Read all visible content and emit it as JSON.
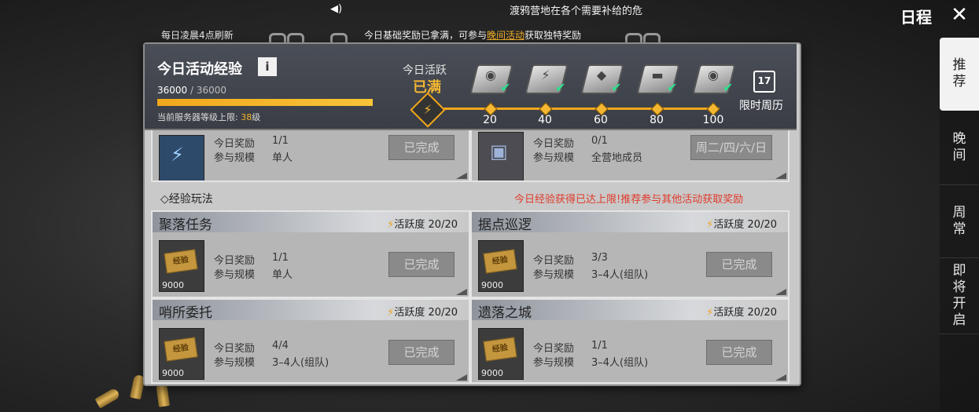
{
  "top": {
    "marquee": "渡鸦营地在各个需要补给的危",
    "schedule_title": "日程",
    "close_icon": "close-x-icon",
    "refresh_note": "每日凌晨4点刷新",
    "exp_note_prefix": "今日基础奖励已拿满，可参与",
    "exp_note_link": "晚间活动",
    "exp_note_suffix": "获取独特奖励"
  },
  "sidebar": {
    "tabs": [
      {
        "label": "推荐",
        "active": true
      },
      {
        "label": "晚间"
      },
      {
        "label": "周常"
      },
      {
        "label": "即将开启"
      }
    ]
  },
  "header": {
    "title": "今日活动经验",
    "info_label": "i",
    "exp_current": "36000",
    "exp_max": " / 36000",
    "exp_progress": 1.0,
    "server_cap_prefix": "当前服务器等级上限: ",
    "server_cap_level": "38",
    "server_cap_suffix": "级",
    "activity_label": "今日活跃",
    "activity_status": "已满",
    "tiers": [
      "20",
      "40",
      "60",
      "80",
      "100"
    ],
    "calendar_label": "限时周历",
    "calendar_day": "17"
  },
  "top_cards": [
    {
      "reward_label": "今日奖励",
      "reward_value": "1/1",
      "scale_label": "参与规模",
      "scale_value": "单人",
      "button": "已完成"
    },
    {
      "reward_label": "今日奖励",
      "reward_value": "0/1",
      "scale_label": "参与规模",
      "scale_value": "全营地成员",
      "button": "周二/四/六/日"
    }
  ],
  "section": {
    "label": "◇经验玩法",
    "warning": "今日经验获得已达上限!推荐参与其他活动获取奖励"
  },
  "cards": [
    {
      "title": "聚落任务",
      "activity": "活跃度 20/20",
      "ticket": "经验",
      "qty": "9000",
      "reward_label": "今日奖励",
      "reward_value": "1/1",
      "scale_label": "参与规模",
      "scale_value": "单人",
      "button": "已完成"
    },
    {
      "title": "据点巡逻",
      "activity": "活跃度 20/20",
      "ticket": "经验",
      "qty": "9000",
      "reward_label": "今日奖励",
      "reward_value": "3/3",
      "scale_label": "参与规模",
      "scale_value": "3–4人(组队)",
      "button": "已完成"
    },
    {
      "title": "哨所委托",
      "activity": "活跃度 20/20",
      "ticket": "经验",
      "qty": "9000",
      "reward_label": "今日奖励",
      "reward_value": "4/4",
      "scale_label": "参与规模",
      "scale_value": "3–4人(组队)",
      "button": "已完成"
    },
    {
      "title": "遗落之城",
      "activity": "活跃度 20/20",
      "ticket": "经验",
      "qty": "9000",
      "reward_label": "今日奖励",
      "reward_value": "1/1",
      "scale_label": "参与规模",
      "scale_value": "3–4人(组队)",
      "button": "已完成"
    }
  ]
}
